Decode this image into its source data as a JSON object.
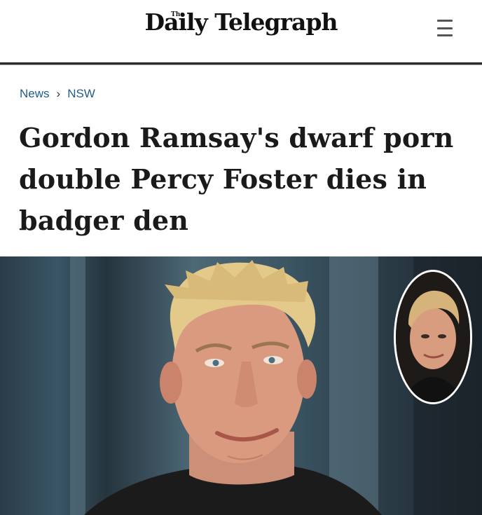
{
  "header": {
    "logo_small": "The",
    "logo_text": "Daily Telegraph"
  },
  "breadcrumb": {
    "items": [
      "News",
      "NSW"
    ],
    "separator": "›"
  },
  "article": {
    "headline": "Gordon Ramsay's dwarf porn double Percy Foster dies in badger den"
  },
  "icons": {
    "menu": "hamburger-menu-icon",
    "chevron": "chevron-right-icon"
  },
  "colors": {
    "link": "#1f5c8b",
    "headline": "#1a1a1a",
    "rule": "#2a2a2a"
  }
}
